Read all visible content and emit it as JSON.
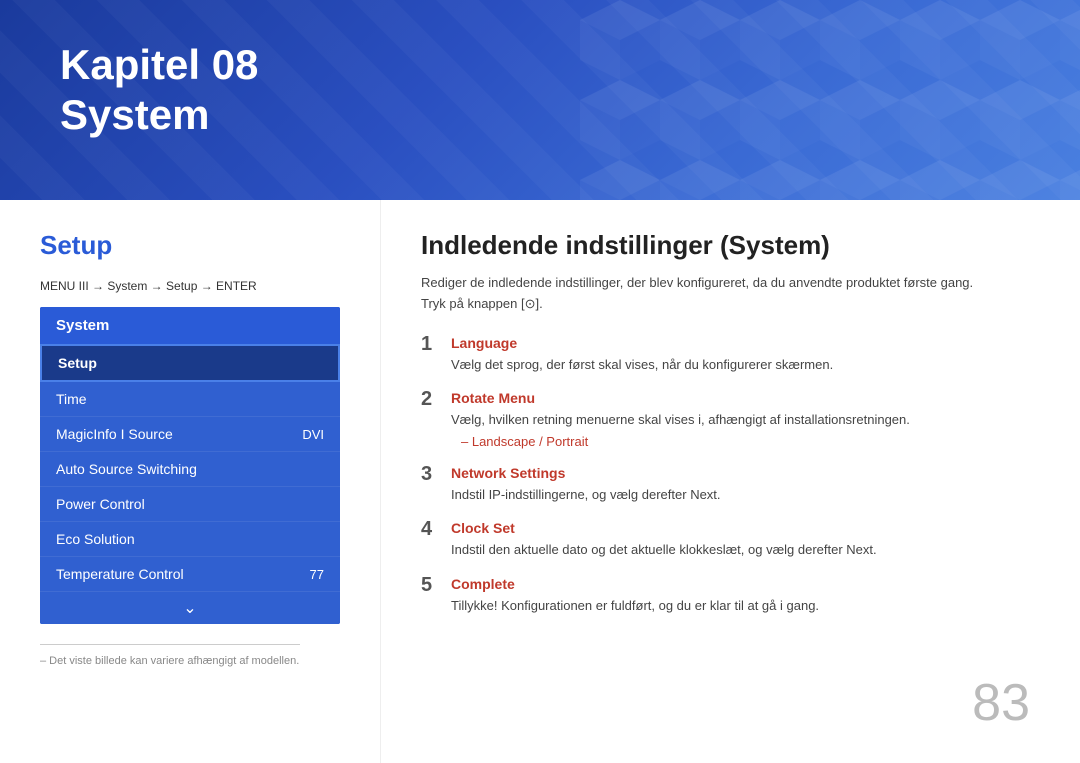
{
  "header": {
    "chapter": "Kapitel 08",
    "subtitle": "System"
  },
  "left": {
    "section_title": "Setup",
    "menu_path": "MENU",
    "menu_path_full": "MENU III → System → Setup → ENTER",
    "menu_header": "System",
    "menu_items": [
      {
        "label": "Setup",
        "value": "",
        "active": true
      },
      {
        "label": "Time",
        "value": "",
        "active": false
      },
      {
        "label": "MagicInfo I Source",
        "value": "DVI",
        "active": false
      },
      {
        "label": "Auto Source Switching",
        "value": "",
        "active": false
      },
      {
        "label": "Power Control",
        "value": "",
        "active": false
      },
      {
        "label": "Eco Solution",
        "value": "",
        "active": false
      },
      {
        "label": "Temperature Control",
        "value": "77",
        "active": false
      }
    ],
    "footnote": "– Det viste billede kan variere afhængigt af modellen."
  },
  "right": {
    "title": "Indledende indstillinger (System)",
    "intro": "Rediger de indledende indstillinger, der blev konfigureret, da du anvendte produktet første gang.\nTryk på knappen [⊙].",
    "steps": [
      {
        "number": "1",
        "name": "Language",
        "desc": "Vælg det sprog, der først skal vises, når du konfigurerer skærmen."
      },
      {
        "number": "2",
        "name": "Rotate Menu",
        "desc": "Vælg, hvilken retning menuerne skal vises i, afhængigt af installationsretningen.",
        "bullet": "– Landscape / Portrait"
      },
      {
        "number": "3",
        "name": "Network Settings",
        "desc": "Indstil IP-indstillingerne, og vælg derefter",
        "highlight": "Next",
        "desc_suffix": "."
      },
      {
        "number": "4",
        "name": "Clock Set",
        "desc": "Indstil den aktuelle dato og det aktuelle klokkeslæt, og vælg derefter",
        "highlight": "Next",
        "desc_suffix": "."
      },
      {
        "number": "5",
        "name": "Complete",
        "desc": "Tillykke! Konfigurationen er fuldført, og du er klar til at gå i gang."
      }
    ]
  },
  "page_number": "83"
}
